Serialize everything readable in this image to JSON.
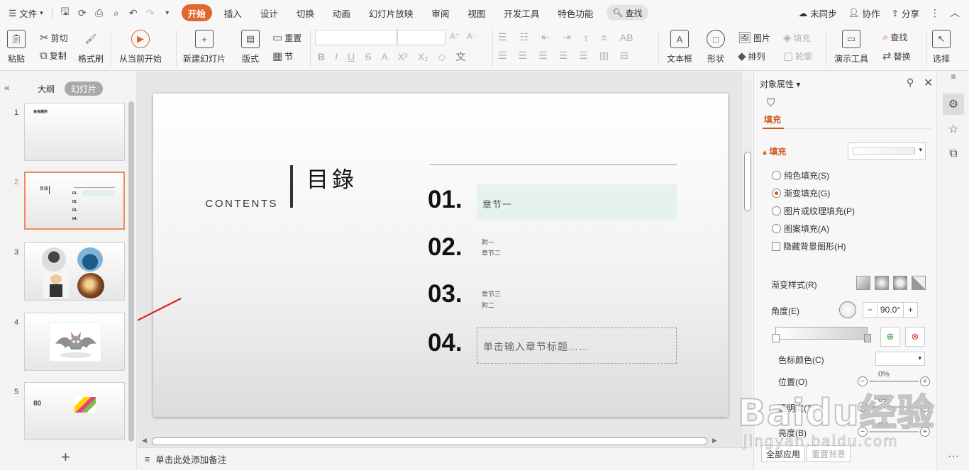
{
  "menubar": {
    "file": "文件",
    "tabs": [
      "开始",
      "插入",
      "设计",
      "切换",
      "动画",
      "幻灯片放映",
      "审阅",
      "视图",
      "开发工具",
      "特色功能"
    ],
    "active_tab": "开始",
    "search": "查找",
    "sync": "未同步",
    "collab": "协作",
    "share": "分享"
  },
  "ribbon": {
    "paste": "粘贴",
    "cut": "剪切",
    "copy": "复制",
    "format_painter": "格式刷",
    "play_from_current": "从当前开始",
    "new_slide": "新建幻灯片",
    "layout": "版式",
    "reset": "重置",
    "section": "节",
    "font_size_increase": "A⁺",
    "font_size_decrease": "A⁻",
    "textbox": "文本框",
    "shape": "形状",
    "picture": "图片",
    "fill": "填充",
    "arrange": "排列",
    "outline": "轮廓",
    "present_tool": "演示工具",
    "find": "查找",
    "replace": "替换",
    "select": "选择"
  },
  "left_panel": {
    "tab_outline": "大纲",
    "tab_slides": "幻灯片",
    "slides": [
      {
        "num": "1",
        "label": "会会越宗"
      },
      {
        "num": "2",
        "label": "目錄"
      },
      {
        "num": "3",
        "label": ""
      },
      {
        "num": "4",
        "label": ""
      },
      {
        "num": "5",
        "label": "80"
      }
    ],
    "selected": "2",
    "add": "+"
  },
  "slide": {
    "title": "目錄",
    "subtitle": "CONTENTS",
    "items": [
      {
        "num": "01.",
        "lines": [
          "章节一"
        ]
      },
      {
        "num": "02.",
        "lines": [
          "附一",
          "章节二"
        ]
      },
      {
        "num": "03.",
        "lines": [
          "章节三",
          "附二"
        ]
      },
      {
        "num": "04.",
        "placeholder": "单击输入章节标题……"
      }
    ]
  },
  "notes": {
    "placeholder": "单击此处添加备注"
  },
  "right_panel": {
    "title": "对象属性",
    "tab": "填充",
    "section": "填充",
    "fill_options": [
      {
        "label": "纯色填充(S)",
        "selected": false
      },
      {
        "label": "渐变填充(G)",
        "selected": true
      },
      {
        "label": "图片或纹理填充(P)",
        "selected": false
      },
      {
        "label": "图案填充(A)",
        "selected": false
      }
    ],
    "hide_bg": "隐藏背景图形(H)",
    "gradient_style": "渐变样式(R)",
    "angle_label": "角度(E)",
    "angle_value": "90.0°",
    "stop_color": "色标颜色(C)",
    "position_label": "位置(O)",
    "position_value": "0%",
    "transparency_label": "透明度(T)",
    "transparency_value": "0%",
    "brightness_label": "亮度(B)",
    "brightness_value": "0%",
    "apply_all": "全部应用",
    "reset_bg": "重置背景"
  },
  "watermark": {
    "text": "Baidu经验",
    "sub": "jingyan.baidu.com"
  },
  "colors": {
    "accent": "#e0682e",
    "selected_thumb_border": "#f08a5d",
    "box1_fill": "#e6f3ec"
  }
}
